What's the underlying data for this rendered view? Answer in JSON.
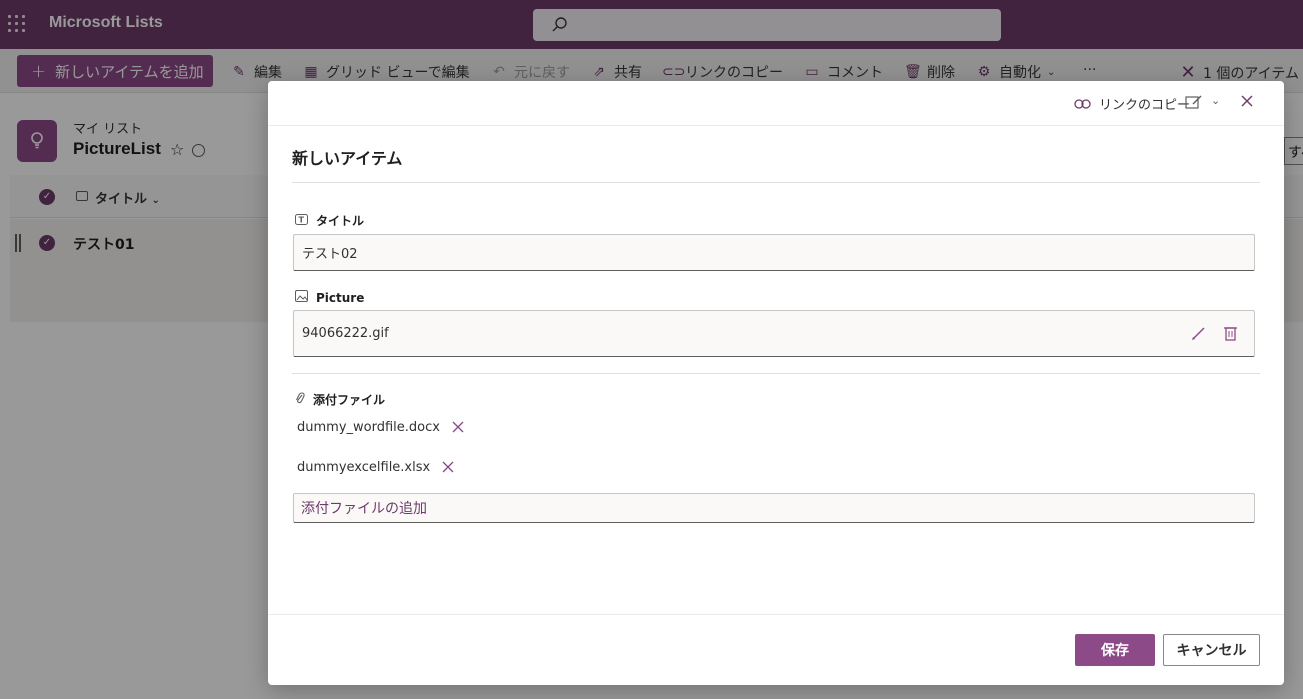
{
  "app": {
    "title": "Microsoft Lists",
    "accent": "#6d3a6a",
    "button_color": "#8c4a89"
  },
  "commandbar": {
    "new_item": "新しいアイテムを追加",
    "edit": "編集",
    "grid_edit": "グリッド ビューで編集",
    "undo": "元に戻す",
    "share": "共有",
    "copy_link": "リンクのコピー",
    "comment": "コメント",
    "delete": "削除",
    "automate": "自動化",
    "more": "···",
    "selection": "1 個のアイテム"
  },
  "list": {
    "breadcrumb": "マイ リスト",
    "name": "PictureList",
    "column_title": "タイトル",
    "rows": [
      {
        "title": "テスト01"
      }
    ],
    "right_fragment": "すべての"
  },
  "dialog": {
    "copy_link": "リンクのコピー",
    "title": "新しいアイテム",
    "fields": {
      "title_label": "タイトル",
      "title_value": "テスト02",
      "picture_label": "Picture",
      "picture_value": "94066222.gif",
      "attachments_label": "添付ファイル"
    },
    "attachments": [
      {
        "name": "dummy_wordfile.docx"
      },
      {
        "name": "dummyexcelfile.xlsx"
      }
    ],
    "add_attachment": "添付ファイルの追加",
    "save": "保存",
    "cancel": "キャンセル"
  }
}
